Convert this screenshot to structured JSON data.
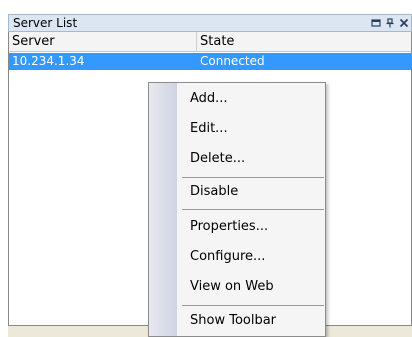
{
  "title_bar": {
    "title": "Server List",
    "icons": [
      "maximize-icon",
      "pin-icon",
      "close-icon"
    ]
  },
  "columns": {
    "server": "Server",
    "state": "State"
  },
  "rows": [
    {
      "server": "10.234.1.34",
      "state": "Connected"
    }
  ],
  "context_menu": {
    "items": [
      "Add...",
      "Edit...",
      "Delete...",
      "Disable",
      "Properties...",
      "Configure...",
      "View on Web",
      "Show Toolbar"
    ]
  },
  "colors": {
    "selection": "#3399ff",
    "title_bar": "#dce6f2",
    "menu_background": "#f5f5f5"
  }
}
